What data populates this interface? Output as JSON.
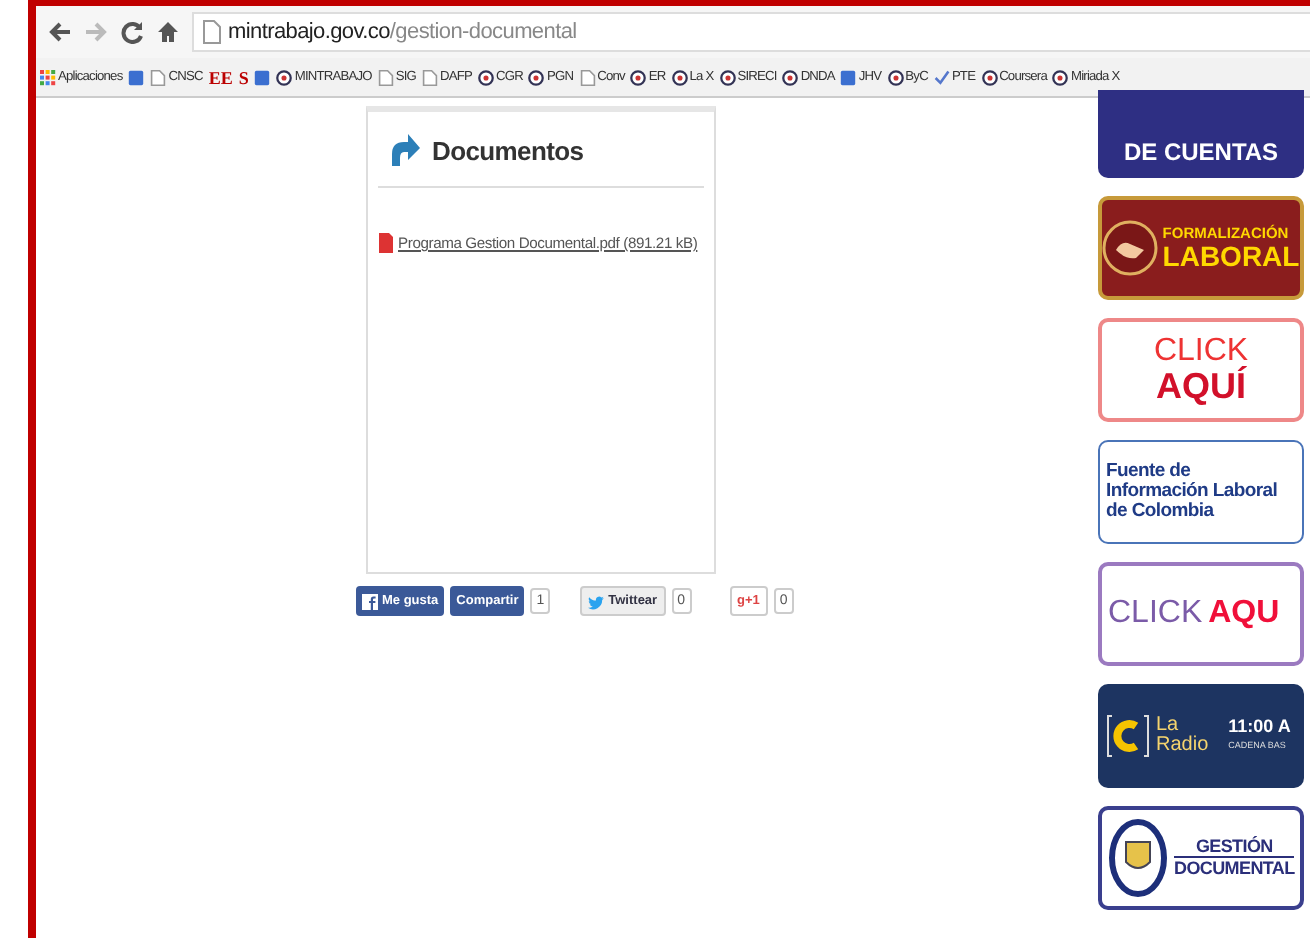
{
  "browser": {
    "url_host": "mintrabajo.gov.co",
    "url_path": "/gestion-documental",
    "bookmarks": [
      {
        "label": "Aplicaciones",
        "kind": "apps"
      },
      {
        "kind": "square"
      },
      {
        "label": "CNSC",
        "kind": "page"
      },
      {
        "label": "EE",
        "kind": "none"
      },
      {
        "label": "S",
        "kind": "none"
      },
      {
        "kind": "square"
      },
      {
        "label": "MINTRABAJO",
        "kind": "seal"
      },
      {
        "label": "SIG",
        "kind": "page"
      },
      {
        "label": "DAFP",
        "kind": "page"
      },
      {
        "label": "CGR",
        "kind": "seal"
      },
      {
        "label": "PGN",
        "kind": "seal"
      },
      {
        "label": "Conv",
        "kind": "page"
      },
      {
        "label": "ER",
        "kind": "seal"
      },
      {
        "label": "La X",
        "kind": "seal"
      },
      {
        "label": "SIRECI",
        "kind": "seal"
      },
      {
        "label": "DNDA",
        "kind": "seal"
      },
      {
        "label": "JHV",
        "kind": "square"
      },
      {
        "label": "ByC",
        "kind": "seal"
      },
      {
        "label": "PTE",
        "kind": "check"
      },
      {
        "label": "Coursera",
        "kind": "seal"
      },
      {
        "label": "Miriada X",
        "kind": "seal"
      }
    ]
  },
  "documents": {
    "title": "Documentos",
    "files": [
      {
        "name": "Programa Gestion Documental.pdf (891.21 kB)"
      }
    ]
  },
  "social": [
    {
      "kind": "facebook",
      "label": "Me gusta"
    },
    {
      "kind": "share",
      "label": "Compartir",
      "count": "1"
    },
    {
      "kind": "twitter",
      "label": "Twittear",
      "count": "0"
    },
    {
      "kind": "gplus",
      "label": "g+1",
      "count": "0"
    }
  ],
  "banners": [
    {
      "kind": "rendicion",
      "lines": [
        "DE CUENTAS"
      ]
    },
    {
      "kind": "formalizacion",
      "lines": [
        "FORMALIZACIÓN",
        "LABORAL"
      ]
    },
    {
      "kind": "click",
      "lines": [
        "CLICK",
        "AQUÍ"
      ]
    },
    {
      "kind": "fuente",
      "lines": [
        "Fuente de",
        "Información Laboral",
        "de Colombia"
      ]
    },
    {
      "kind": "click_inline",
      "lines": [
        "CLICK",
        "AQU"
      ]
    },
    {
      "kind": "radio",
      "lines": [
        "La",
        "11:00 A",
        "Radio",
        "CADENA BAS"
      ]
    },
    {
      "kind": "gestion",
      "lines": [
        "GESTIÓN",
        "DOCUMENTAL"
      ]
    }
  ]
}
